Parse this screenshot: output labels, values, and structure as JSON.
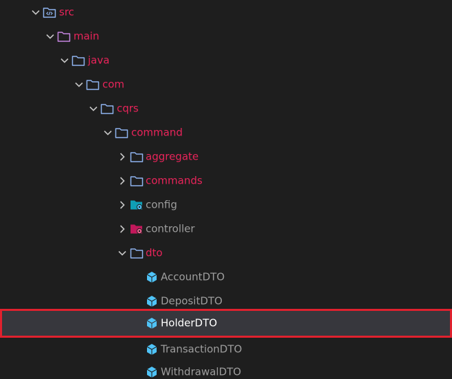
{
  "explorer": {
    "items": [
      {
        "label": "src",
        "color": "#e8245a"
      },
      {
        "label": "main",
        "color": "#e8245a"
      },
      {
        "label": "java",
        "color": "#e8245a"
      },
      {
        "label": "com",
        "color": "#e8245a"
      },
      {
        "label": "cqrs",
        "color": "#e8245a"
      },
      {
        "label": "command",
        "color": "#e8245a"
      },
      {
        "label": "aggregate",
        "color": "#e8245a"
      },
      {
        "label": "commands",
        "color": "#e8245a"
      },
      {
        "label": "config",
        "color": "#9d9d9d"
      },
      {
        "label": "controller",
        "color": "#9d9d9d"
      },
      {
        "label": "dto",
        "color": "#e8245a"
      },
      {
        "label": "AccountDTO",
        "color": "#9d9d9d"
      },
      {
        "label": "DepositDTO",
        "color": "#9d9d9d"
      },
      {
        "label": "HolderDTO",
        "color": "#ffffff",
        "selected": true
      },
      {
        "label": "TransactionDTO",
        "color": "#9d9d9d"
      },
      {
        "label": "WithdrawalDTO",
        "color": "#9d9d9d"
      }
    ]
  },
  "colors": {
    "background": "#1e1e1e",
    "selected_background": "#37373d",
    "selection_outline": "#e0212e",
    "folder_icon": "#8fb4f0",
    "file_icon": "#4fc3f7",
    "modified_label": "#e8245a"
  }
}
